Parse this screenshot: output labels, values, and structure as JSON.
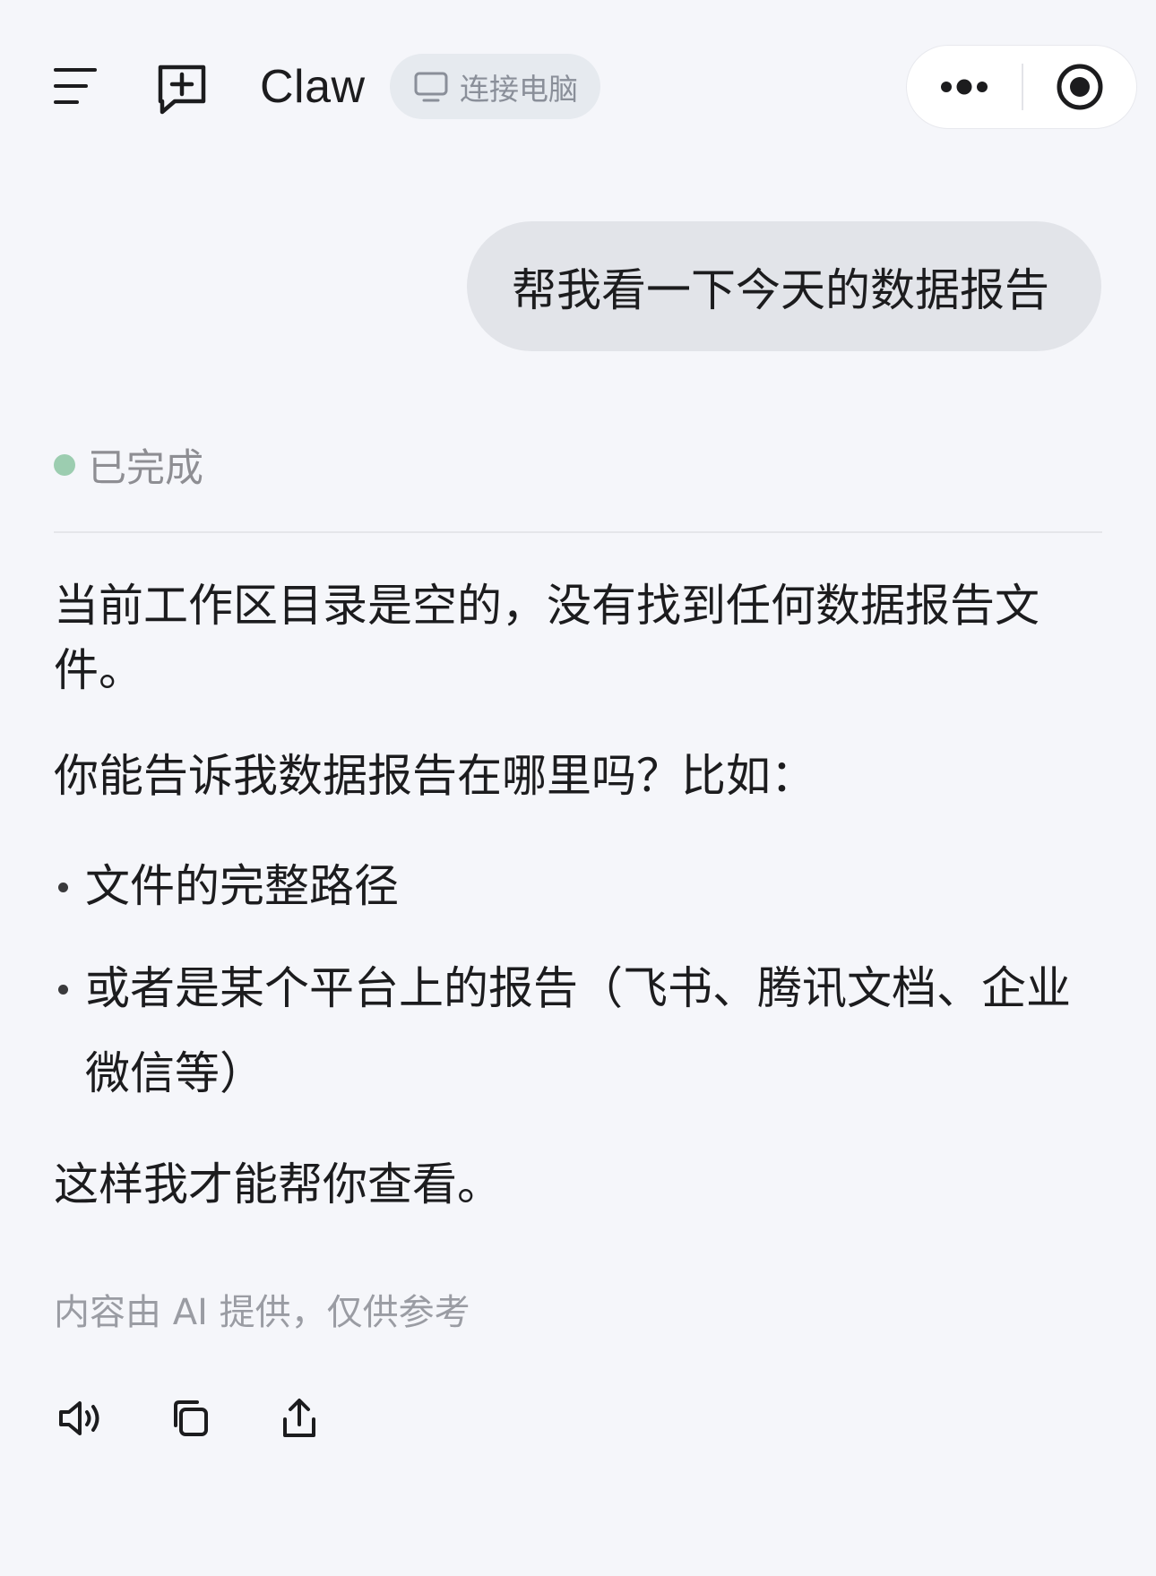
{
  "header": {
    "title": "Claw",
    "menu_icon": "menu-icon",
    "new_chat_icon": "new-chat-icon",
    "connect": {
      "label": "连接电脑",
      "icon": "monitor-icon"
    },
    "capsule": {
      "more_icon": "more-icon",
      "record_icon": "record-icon"
    }
  },
  "conversation": {
    "user_message": "帮我看一下今天的数据报告",
    "status": {
      "label": "已完成",
      "color": "#9ccdb0"
    },
    "assistant": {
      "paragraph1": "当前工作区目录是空的，没有找到任何数据报告文件。",
      "paragraph2": "你能告诉我数据报告在哪里吗？比如：",
      "bullets": [
        "文件的完整路径",
        "或者是某个平台上的报告（飞书、腾讯文档、企业微信等）"
      ],
      "paragraph3": "这样我才能帮你查看。"
    },
    "disclaimer": "内容由 AI 提供，仅供参考",
    "actions": {
      "speak_icon": "speaker-icon",
      "copy_icon": "copy-icon",
      "share_icon": "share-icon"
    }
  },
  "colors": {
    "background": "#f5f6fa",
    "bubble": "#e2e4e9",
    "pill": "#e6eaef"
  }
}
